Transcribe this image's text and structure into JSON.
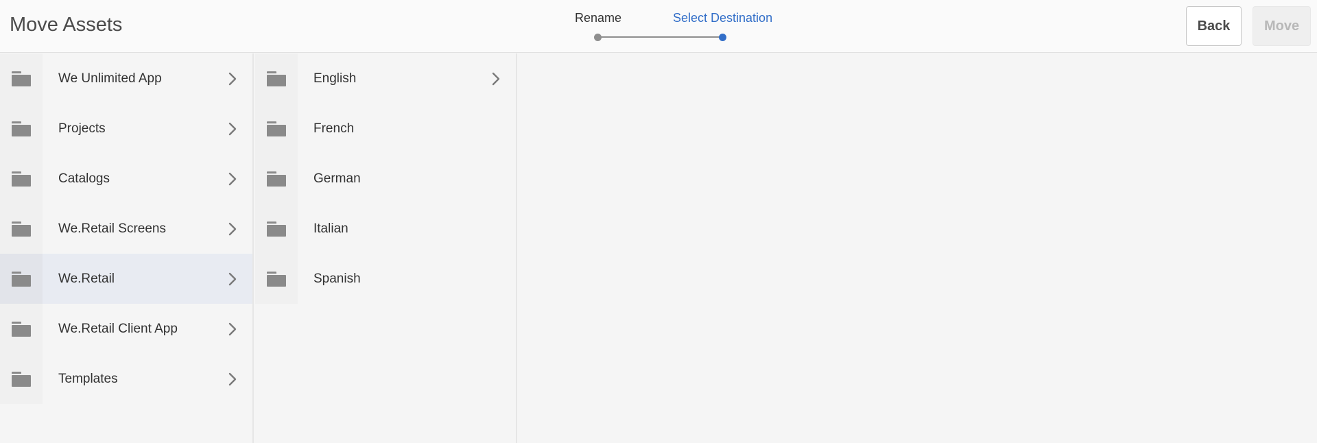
{
  "header": {
    "title": "Move Assets",
    "steps": [
      {
        "label": "Rename",
        "state": "done"
      },
      {
        "label": "Select Destination",
        "state": "active"
      }
    ],
    "back_label": "Back",
    "move_label": "Move",
    "colors": {
      "accent": "#326ec8",
      "step_inactive": "#8e8e8e"
    }
  },
  "columns": [
    {
      "items": [
        {
          "label": "We Unlimited App",
          "has_children": true,
          "selected": false
        },
        {
          "label": "Projects",
          "has_children": true,
          "selected": false
        },
        {
          "label": "Catalogs",
          "has_children": true,
          "selected": false
        },
        {
          "label": "We.Retail Screens",
          "has_children": true,
          "selected": false
        },
        {
          "label": "We.Retail",
          "has_children": true,
          "selected": true
        },
        {
          "label": "We.Retail Client App",
          "has_children": true,
          "selected": false
        },
        {
          "label": "Templates",
          "has_children": true,
          "selected": false
        }
      ]
    },
    {
      "items": [
        {
          "label": "English",
          "has_children": true,
          "selected": false
        },
        {
          "label": "French",
          "has_children": false,
          "selected": false
        },
        {
          "label": "German",
          "has_children": false,
          "selected": false
        },
        {
          "label": "Italian",
          "has_children": false,
          "selected": false
        },
        {
          "label": "Spanish",
          "has_children": false,
          "selected": false
        }
      ]
    }
  ]
}
